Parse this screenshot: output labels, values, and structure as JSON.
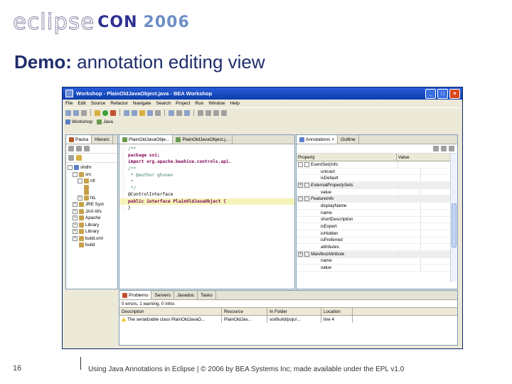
{
  "header": {
    "logo_eclipse": "eclipse",
    "logo_con": "CON",
    "logo_year": "2006",
    "title_bold": "Demo:",
    "title_rest": " annotation editing view"
  },
  "footer": {
    "page_number": "16",
    "text": "Using Java Annotations in Eclipse  |  © 2006 by BEA Systems Inc; made available under the EPL v1.0"
  },
  "window": {
    "title": "Workshop - PlainOldJavaObject.java - BEA Workshop",
    "buttons": [
      "_",
      "□",
      "×"
    ],
    "menu": [
      "File",
      "Edit",
      "Source",
      "Refactor",
      "Navigate",
      "Search",
      "Project",
      "Run",
      "Window",
      "Help"
    ],
    "perspectives": [
      "Workshop",
      "Java"
    ]
  },
  "explorer": {
    "tabs": [
      "Packa",
      "Hierarc"
    ],
    "tree": [
      {
        "indent": 0,
        "exp": "-",
        "label": "shdhr"
      },
      {
        "indent": 1,
        "exp": "-",
        "label": "src"
      },
      {
        "indent": 2,
        "exp": "-",
        "label": "ntl"
      },
      {
        "indent": 2,
        "exp": "",
        "label": ""
      },
      {
        "indent": 2,
        "exp": "",
        "label": ""
      },
      {
        "indent": 2,
        "exp": "+",
        "label": "NL"
      },
      {
        "indent": 1,
        "exp": "+",
        "label": "JRE Syst"
      },
      {
        "indent": 1,
        "exp": "+",
        "label": "JAX-Ws"
      },
      {
        "indent": 1,
        "exp": "+",
        "label": "Apache"
      },
      {
        "indent": 1,
        "exp": "+",
        "label": "Library"
      },
      {
        "indent": 1,
        "exp": "+",
        "label": "Library"
      },
      {
        "indent": 1,
        "exp": "+",
        "label": "build.xml"
      },
      {
        "indent": 1,
        "exp": "",
        "label": "build"
      }
    ]
  },
  "editor": {
    "tabs": [
      "PlainOldJavaObje...",
      "PlainOldJavaObject.j..."
    ],
    "lines": [
      {
        "t": "/**",
        "cls": "cm"
      },
      {
        "t": "package soi;",
        "cls": "kw"
      },
      {
        "t": "",
        "cls": ""
      },
      {
        "t": "import org.apache.beehive.controls.api.",
        "cls": "kw"
      },
      {
        "t": "",
        "cls": ""
      },
      {
        "t": "/**",
        "cls": "cm"
      },
      {
        "t": " * @author ghunen",
        "cls": "cm"
      },
      {
        "t": " *",
        "cls": "cm"
      },
      {
        "t": " */",
        "cls": "cm"
      },
      {
        "t": "@ControlInterface",
        "cls": ""
      },
      {
        "t": "public interface PlainOldJavaObject {",
        "cls": "kw hl"
      },
      {
        "t": "",
        "cls": ""
      },
      {
        "t": "}",
        "cls": ""
      }
    ]
  },
  "annotations": {
    "tabs": [
      "Annotations",
      "Outline"
    ],
    "columns": [
      "Property",
      "Value"
    ],
    "rows": [
      {
        "label": "EventSet(Info",
        "indent": 0,
        "cat": false,
        "exp": "-"
      },
      {
        "label": "unicast",
        "indent": 2,
        "cat": false,
        "exp": ""
      },
      {
        "label": "isDefault",
        "indent": 2,
        "cat": false,
        "exp": ""
      },
      {
        "label": "ExternalPropertySets",
        "indent": 0,
        "cat": true,
        "exp": "+"
      },
      {
        "label": "value",
        "indent": 2,
        "cat": false,
        "exp": ""
      },
      {
        "label": "FeatureInfo",
        "indent": 0,
        "cat": true,
        "exp": "-"
      },
      {
        "label": "displayName",
        "indent": 2,
        "cat": false,
        "exp": ""
      },
      {
        "label": "name",
        "indent": 2,
        "cat": false,
        "exp": ""
      },
      {
        "label": "shortDescription",
        "indent": 2,
        "cat": false,
        "exp": ""
      },
      {
        "label": "isExpert",
        "indent": 2,
        "cat": false,
        "exp": ""
      },
      {
        "label": "isHidden",
        "indent": 2,
        "cat": false,
        "exp": ""
      },
      {
        "label": "isPreferred",
        "indent": 2,
        "cat": false,
        "exp": ""
      },
      {
        "label": "attributes",
        "indent": 2,
        "cat": false,
        "exp": ""
      },
      {
        "label": "ManifestAttribute",
        "indent": 0,
        "cat": true,
        "exp": "+"
      },
      {
        "label": "name",
        "indent": 2,
        "cat": false,
        "exp": ""
      },
      {
        "label": "value",
        "indent": 2,
        "cat": false,
        "exp": ""
      }
    ]
  },
  "problems": {
    "tabs": [
      "Problems",
      "Servers",
      "Javadoc",
      "Tasks"
    ],
    "summary": "0 errors, 1 warning, 0 infos",
    "columns": [
      "Description",
      "Resource",
      "In Folder",
      "Location"
    ],
    "rows": [
      {
        "description": "The serializable class PlainOldJavaO...",
        "resource": "PlainOldJav...",
        "folder": "soi/build/pojo/...",
        "location": "line 4"
      }
    ]
  }
}
